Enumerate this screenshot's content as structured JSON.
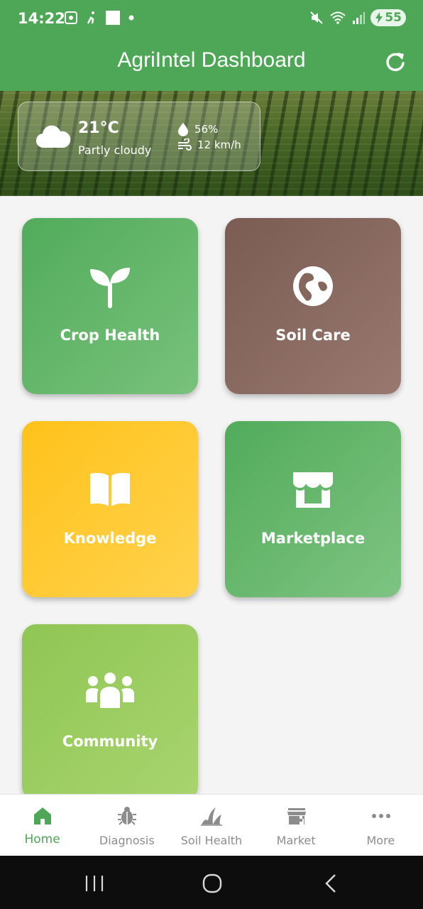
{
  "status_bar": {
    "time": "14:22",
    "battery": "55",
    "icons": [
      "screenshot-icon",
      "walk-icon",
      "square-icon",
      "dot-icon",
      "mute-icon",
      "wifi-icon",
      "signal-icon",
      "battery-charging-icon"
    ]
  },
  "app_bar": {
    "title": "AgriIntel Dashboard",
    "refresh_icon": "refresh-icon"
  },
  "weather": {
    "icon": "cloud-icon",
    "temperature": "21°C",
    "condition": "Partly cloudy",
    "humidity": "56%",
    "wind": "12 km/h"
  },
  "tiles": [
    {
      "label": "Crop Health",
      "icon": "sprout-icon",
      "color": "#52ab5b"
    },
    {
      "label": "Soil Care",
      "icon": "globe-icon",
      "color": "#7a5c53"
    },
    {
      "label": "Knowledge",
      "icon": "book-icon",
      "color": "#ffc21a"
    },
    {
      "label": "Marketplace",
      "icon": "store-icon",
      "color": "#52ab5b"
    },
    {
      "label": "Community",
      "icon": "people-icon",
      "color": "#8fc654"
    }
  ],
  "bottom_nav": [
    {
      "label": "Home",
      "icon": "home-icon",
      "active": true
    },
    {
      "label": "Diagnosis",
      "icon": "bug-icon",
      "active": false
    },
    {
      "label": "Soil Health",
      "icon": "grass-icon",
      "active": false
    },
    {
      "label": "Market",
      "icon": "store-icon",
      "active": false
    },
    {
      "label": "More",
      "icon": "more-dots-icon",
      "active": false
    }
  ],
  "colors": {
    "primary": "#4ea756",
    "inactive_nav": "#8c8c8c",
    "background": "#f4f4f4"
  }
}
